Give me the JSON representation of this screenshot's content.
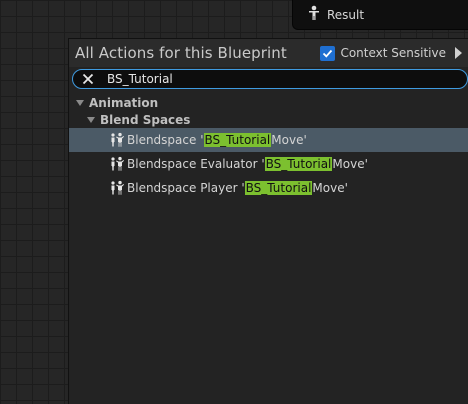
{
  "result_node": {
    "icon": "person-icon",
    "label": "Result"
  },
  "panel": {
    "title": "All Actions for this Blueprint",
    "context_sensitive": {
      "label": "Context Sensitive",
      "checked": true
    }
  },
  "search": {
    "value": "BS_Tutorial",
    "placeholder": ""
  },
  "categories": [
    {
      "label": "Animation"
    },
    {
      "label": "Blend Spaces"
    }
  ],
  "items": [
    {
      "prefix": "Blendspace '",
      "match": "BS_Tutorial",
      "suffix": "Move'",
      "icon": "blendspace-icon",
      "selected": true
    },
    {
      "prefix": "Blendspace Evaluator '",
      "match": "BS_Tutorial",
      "suffix": "Move'",
      "icon": "blendspace-icon",
      "selected": false
    },
    {
      "prefix": "Blendspace Player '",
      "match": "BS_Tutorial",
      "suffix": "Move'",
      "icon": "blendspace-icon",
      "selected": false
    }
  ],
  "colors": {
    "highlight": "#7cc02f",
    "selection": "#4b5a66",
    "accent": "#1f6fd1"
  }
}
